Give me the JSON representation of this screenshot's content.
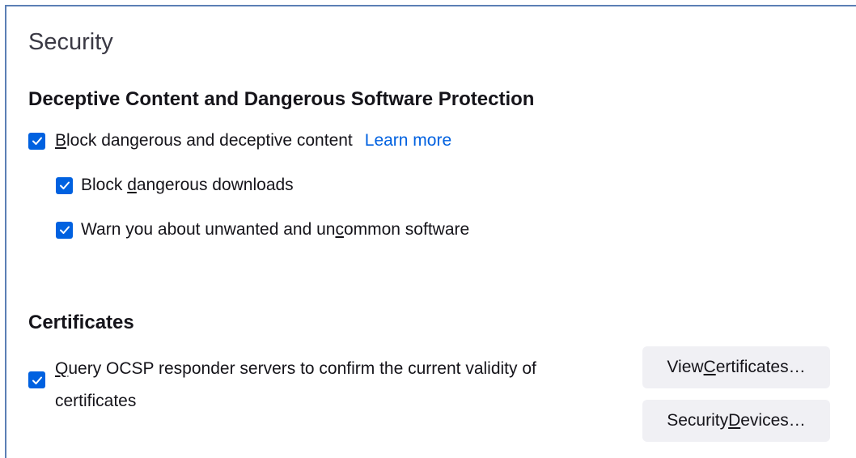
{
  "security": {
    "title": "Security",
    "deceptive": {
      "heading": "Deceptive Content and Dangerous Software Protection",
      "block_content": {
        "label_first": "B",
        "label_rest": "lock dangerous and deceptive content",
        "checked": true,
        "learn_more": "Learn more"
      },
      "block_downloads": {
        "label_pre": "Block ",
        "label_key": "d",
        "label_post": "angerous downloads",
        "checked": true
      },
      "warn_unwanted": {
        "label_pre": "Warn you about unwanted and un",
        "label_key": "c",
        "label_post": "ommon software",
        "checked": true
      }
    },
    "certificates": {
      "heading": "Certificates",
      "ocsp": {
        "label_key": "Q",
        "label_rest": "uery OCSP responder servers to confirm the current validity of certificates",
        "checked": true
      },
      "view_button": {
        "pre": "View ",
        "key": "C",
        "post": "ertificates…"
      },
      "devices_button": {
        "pre": "Security ",
        "key": "D",
        "post": "evices…"
      }
    }
  },
  "colors": {
    "accent": "#0061e0",
    "frame_border": "#5b7fb5",
    "button_bg": "#f0f0f4",
    "text": "#15141a"
  },
  "icons": {
    "checkbox": "checkmark-icon"
  }
}
